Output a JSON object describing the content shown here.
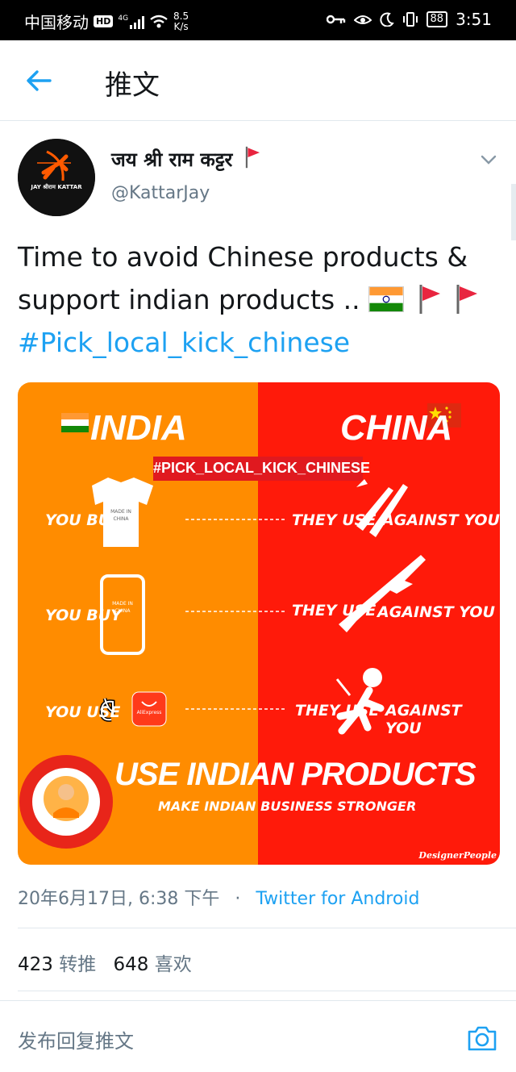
{
  "status_bar": {
    "carrier": "中国移动",
    "hd": "HD",
    "network": "4G",
    "speed_value": "8.5",
    "speed_unit": "K/s",
    "battery": "88",
    "time": "3:51"
  },
  "app_bar": {
    "title": "推文"
  },
  "tweet": {
    "display_name": "जय श्री राम कट्टर",
    "handle": "@KattarJay",
    "avatar_text": "JAY श्रीराम KATTAR",
    "text_line1": "Time to avoid Chinese products &",
    "text_line2": "support indian products ..",
    "hashtag": "#Pick_local_kick_chinese",
    "timestamp": "20年6月17日, 6:38 下午",
    "separator": "·",
    "via": "Twitter for Android",
    "retweet_count": "423",
    "retweet_label": "转推",
    "like_count": "648",
    "like_label": "喜欢"
  },
  "media": {
    "left_title": "INDIA",
    "right_title": "CHINA",
    "banner": "#PICK_LOCAL_KICK_CHINESE",
    "row1_left": "YOU BUY",
    "row1_made_in": "MADE IN CHINA",
    "row2_left": "YOU BUY",
    "row2_made_in": "MADE IN CHINA",
    "row3_left": "YOU USE",
    "row3_app": "AliExpress",
    "they_use": "THEY USE",
    "against_you": "AGAINST YOU",
    "cta": "USE INDIAN PRODUCTS",
    "sub_cta": "MAKE INDIAN BUSINESS STRONGER",
    "credit": "DesignerPeople"
  },
  "reply": {
    "placeholder": "发布回复推文"
  },
  "colors": {
    "accent": "#1da1f2",
    "orange": "#ff8c00",
    "red": "#ff1a0a",
    "text": "#14171a",
    "muted": "#657786"
  }
}
